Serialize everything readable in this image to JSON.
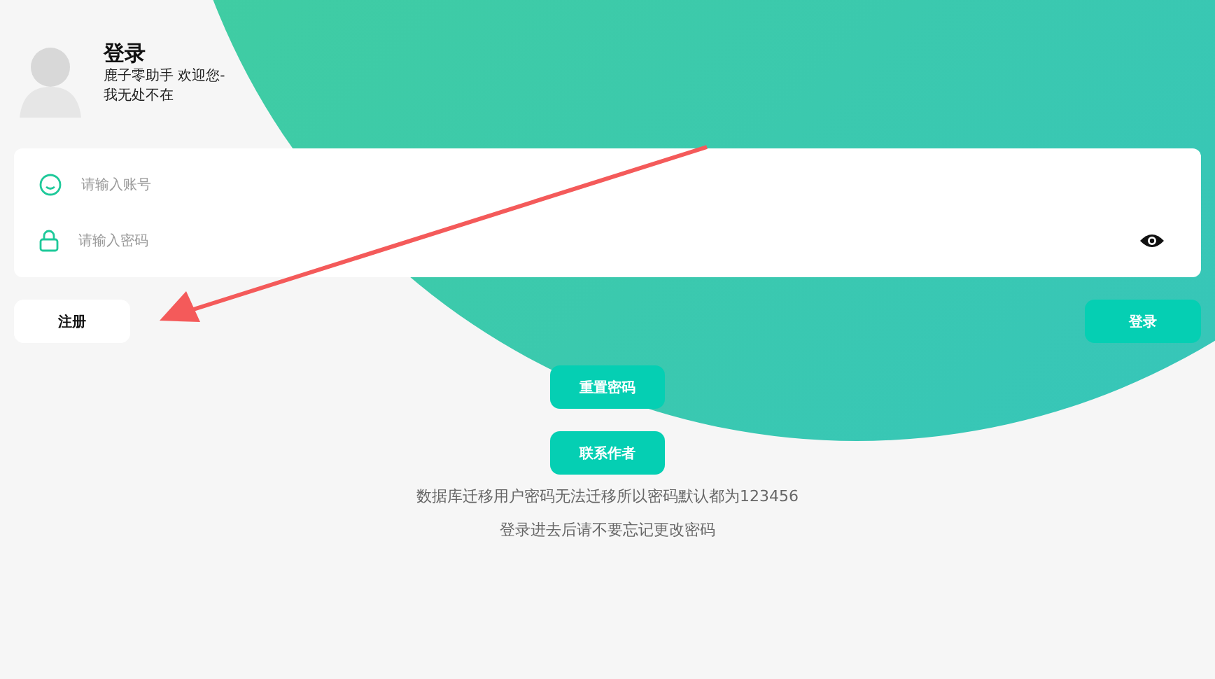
{
  "header": {
    "title": "登录",
    "subtitle": "鹿子零助手 欢迎您-我无处不在"
  },
  "form": {
    "account": {
      "placeholder": "请输入账号"
    },
    "password": {
      "placeholder": "请输入密码"
    }
  },
  "buttons": {
    "register": "注册",
    "login": "登录",
    "reset": "重置密码",
    "contact": "联系作者"
  },
  "notes": [
    "数据库迁移用户密码无法迁移所以密码默认都为123456",
    "登录进去后请不要忘记更改密码"
  ]
}
